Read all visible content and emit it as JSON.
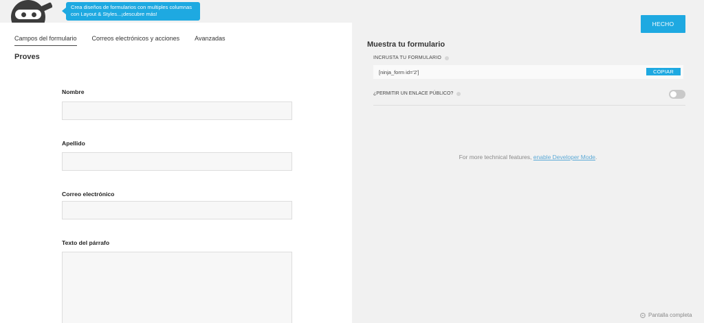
{
  "tooltip": "Crea diseños de formularios con multiples columnas con Layout & Styles...¡descubre más!",
  "tabs": [
    {
      "label": "Campos del formulario"
    },
    {
      "label": "Correos electrónicos y acciones"
    },
    {
      "label": "Avanzadas"
    }
  ],
  "form": {
    "title": "Proves",
    "fields": [
      {
        "label": "Nombre"
      },
      {
        "label": "Apellido"
      },
      {
        "label": "Correo electrónico"
      },
      {
        "label": "Texto del párrafo"
      }
    ]
  },
  "header": {
    "done_label": "HECHO"
  },
  "share": {
    "title": "Muestra tu formulario",
    "embed_label": "INCRUSTA TU FORMULARIO",
    "embed_code": "[ninja_form id='2']",
    "copy_label": "COPIAR",
    "public_label": "¿PERMITIR UN ENLACE PÚBLICO?",
    "public_enabled": false
  },
  "developer": {
    "text": "For more technical features, ",
    "link": "enable Developer Mode",
    "suffix": "."
  },
  "footer": {
    "fullscreen_label": "Pantalla completa"
  },
  "colors": {
    "accent": "#1ea9e1",
    "panel": "#f1f1f1"
  }
}
